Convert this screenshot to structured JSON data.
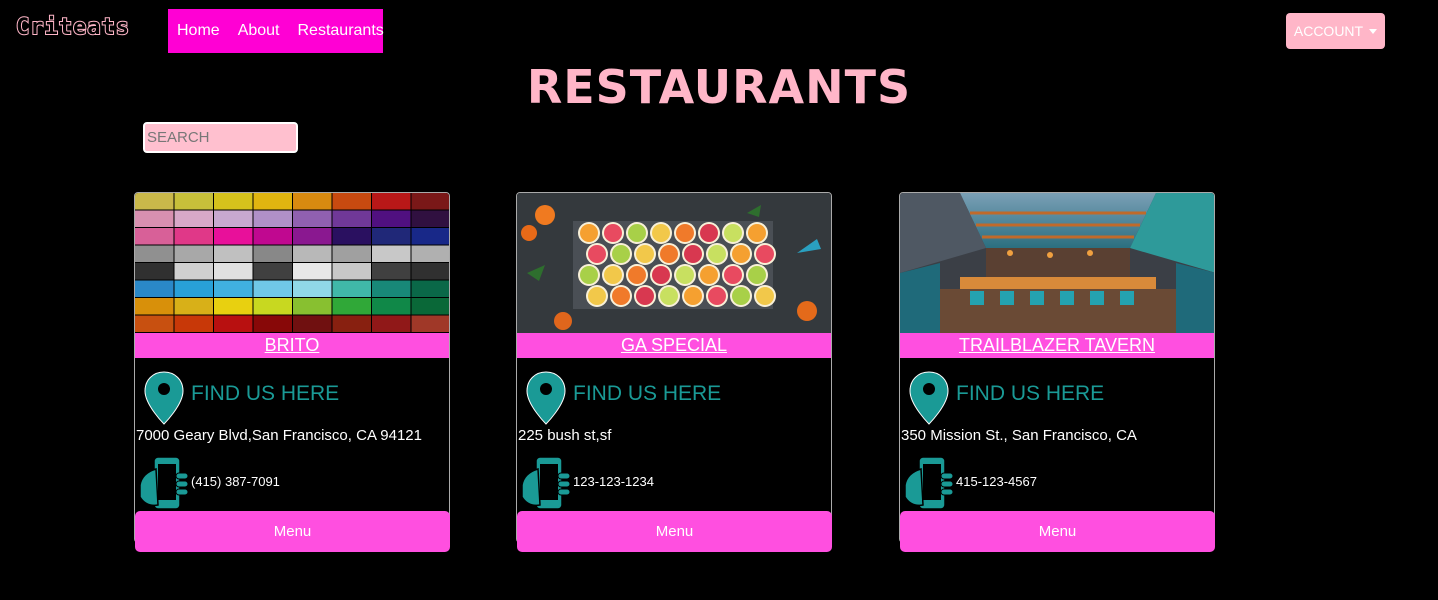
{
  "brand": {
    "logo": "Criteats"
  },
  "nav": {
    "items": [
      "Home",
      "About",
      "Restaurants"
    ]
  },
  "account": {
    "label": "ACCOUNT"
  },
  "page": {
    "title": "RESTAURANTS"
  },
  "search": {
    "placeholder": "SEARCH",
    "value": ""
  },
  "colors": {
    "accent_pink": "#ff4fe0",
    "nav_magenta": "#ff00d4",
    "light_pink": "#ffb6c8",
    "teal": "#1a9a96"
  },
  "restaurants": [
    {
      "name": "BRITO",
      "find_label": "FIND US HERE",
      "address": "7000 Geary Blvd,San Francisco, CA 94121",
      "phone": "(415) 387-7091",
      "menu_label": "Menu",
      "image": "color-swatch-grid"
    },
    {
      "name": "GA SPECIAL",
      "find_label": "FIND US HERE",
      "address": "225 bush st,sf",
      "phone": "123-123-1234",
      "menu_label": "Menu",
      "image": "citrus-slices"
    },
    {
      "name": "TRAILBLAZER TAVERN",
      "find_label": "FIND US HERE",
      "address": "350 Mission St., San Francisco, CA",
      "phone": "415-123-4567",
      "menu_label": "Menu",
      "image": "tavern-bar-interior"
    }
  ]
}
